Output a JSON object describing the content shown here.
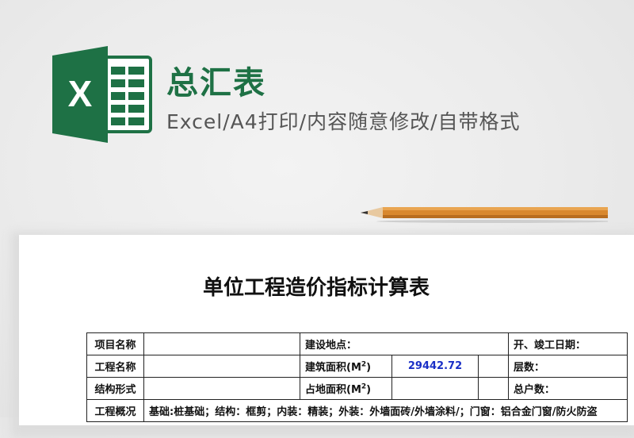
{
  "header": {
    "title": "总汇表",
    "subtitle": "Excel/A4打印/内容随意修改/自带格式",
    "logo_letter": "X",
    "icons": [
      "excel-logo-icon",
      "pencil-icon"
    ]
  },
  "colors": {
    "excel_green": "#1e7145",
    "value_blue": "#1a2fc6",
    "subtitle_gray": "#555555"
  },
  "sheet": {
    "title": "单位工程造价指标计算表",
    "rows": [
      {
        "label1": "项目名称",
        "val1": "",
        "label2": "建设地点：",
        "val2": "",
        "label3": "开、竣工日期：",
        "val3": ""
      },
      {
        "label1": "工程名称",
        "val1": "",
        "label2": "建筑面积(M",
        "label2_sup": "2",
        "label2_end": ")",
        "val2": "29442.72",
        "label3": "层数：",
        "val3": ""
      },
      {
        "label1": "结构形式",
        "val1": "",
        "label2": "占地面积(M",
        "label2_sup": "2",
        "label2_end": ")",
        "val2": "",
        "label3": "总户数：",
        "val3": ""
      }
    ],
    "partial_row": {
      "label": "工程概况",
      "text": "基础:桩基础；结构：框剪；内装：精装；外装：外墙面砖/外墙涂料/；门窗：铝合金门窗/防火防盗"
    }
  }
}
